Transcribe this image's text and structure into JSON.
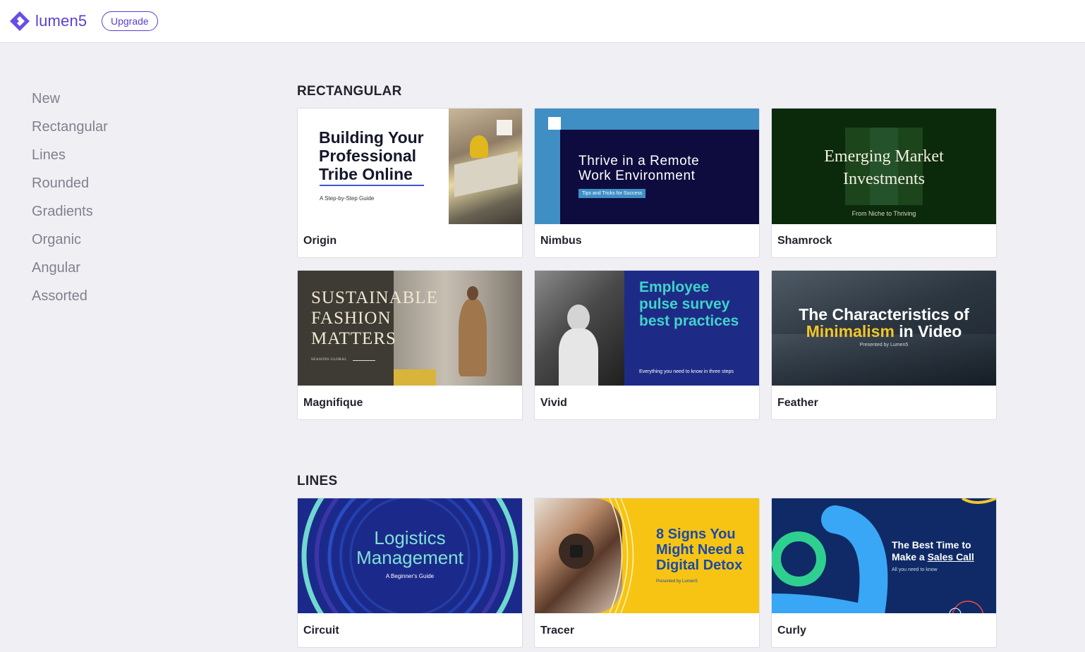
{
  "header": {
    "logo_text": "lumen5",
    "upgrade_label": "Upgrade",
    "brand_color": "#5b3fd1"
  },
  "sidebar": {
    "items": [
      {
        "label": "New"
      },
      {
        "label": "Rectangular"
      },
      {
        "label": "Lines"
      },
      {
        "label": "Rounded"
      },
      {
        "label": "Gradients"
      },
      {
        "label": "Organic"
      },
      {
        "label": "Angular"
      },
      {
        "label": "Assorted"
      }
    ]
  },
  "sections": [
    {
      "title": "RECTANGULAR",
      "templates": [
        {
          "name": "Origin",
          "thumb": {
            "title": "Building Your Professional Tribe Online",
            "line1": "Building Your",
            "line2": "Professional",
            "line3": "Tribe Online",
            "subtitle": "A Step-by-Step Guide"
          }
        },
        {
          "name": "Nimbus",
          "thumb": {
            "line1": "Thrive in a Remote",
            "line2": "Work Environment",
            "subtitle": "Tips and Tricks for Success"
          }
        },
        {
          "name": "Shamrock",
          "thumb": {
            "line1": "Emerging Market",
            "line2": "Investments",
            "subtitle": "From Niche to Thriving"
          }
        },
        {
          "name": "Magnifique",
          "thumb": {
            "line1": "SUSTAINABLE",
            "line2": "FASHION",
            "line3": "MATTERS",
            "subtitle": "SEASONS GLOBAL"
          }
        },
        {
          "name": "Vivid",
          "thumb": {
            "line1": "Employee",
            "line2": "pulse survey",
            "line3": "best practices",
            "subtitle": "Everything you need to know in three steps"
          }
        },
        {
          "name": "Feather",
          "thumb": {
            "line1": "The Characteristics of",
            "line2a": "Minimalism",
            "line2b": " in Video",
            "subtitle": "Presented by Lumen5"
          }
        }
      ]
    },
    {
      "title": "LINES",
      "templates": [
        {
          "name": "Circuit",
          "thumb": {
            "line1": "Logistics",
            "line2": "Management",
            "subtitle": "A Beginner's Guide"
          }
        },
        {
          "name": "Tracer",
          "thumb": {
            "line1": "8 Signs You",
            "line2": "Might Need a",
            "line3": "Digital Detox",
            "subtitle": "Presented by Lumen5"
          }
        },
        {
          "name": "Curly",
          "thumb": {
            "line1": "The Best Time to",
            "line2a": "Make a ",
            "line2b": "Sales Call",
            "subtitle": "All you need to know"
          }
        }
      ]
    }
  ]
}
